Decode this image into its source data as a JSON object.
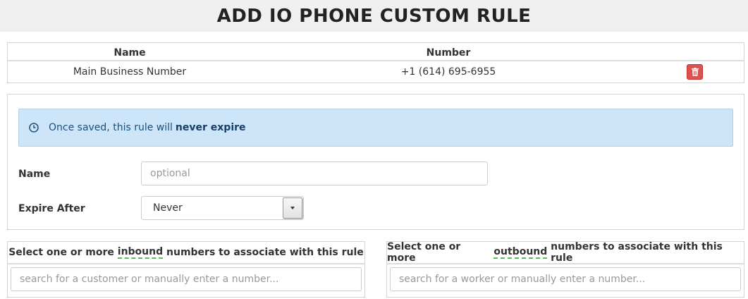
{
  "page": {
    "title": "ADD IO PHONE CUSTOM RULE"
  },
  "numbers_table": {
    "headers": [
      "Name",
      "Number",
      ""
    ],
    "rows": [
      {
        "name": "Main Business Number",
        "number": "+1 (614) 695-6955"
      }
    ],
    "delete_icon": "trash-icon",
    "delete_color": "#d9534f"
  },
  "rule_form": {
    "alert": {
      "icon": "clock-icon",
      "text": "Once saved, this rule will",
      "emphasis": "never expire"
    },
    "name_label": "Name",
    "name_value": "",
    "name_placeholder": "optional",
    "expire_label": "Expire After",
    "expire_value": "Never"
  },
  "inbound": {
    "title_prefix": "Select one or more",
    "title_keyword": "inbound",
    "title_suffix": "numbers to associate with this rule",
    "placeholder": "search for a customer or manually enter a number..."
  },
  "outbound": {
    "title_prefix": "Select one or more",
    "title_keyword": "outbound",
    "title_suffix": "numbers to associate with this rule",
    "placeholder": "search for a worker or manually enter a number..."
  }
}
